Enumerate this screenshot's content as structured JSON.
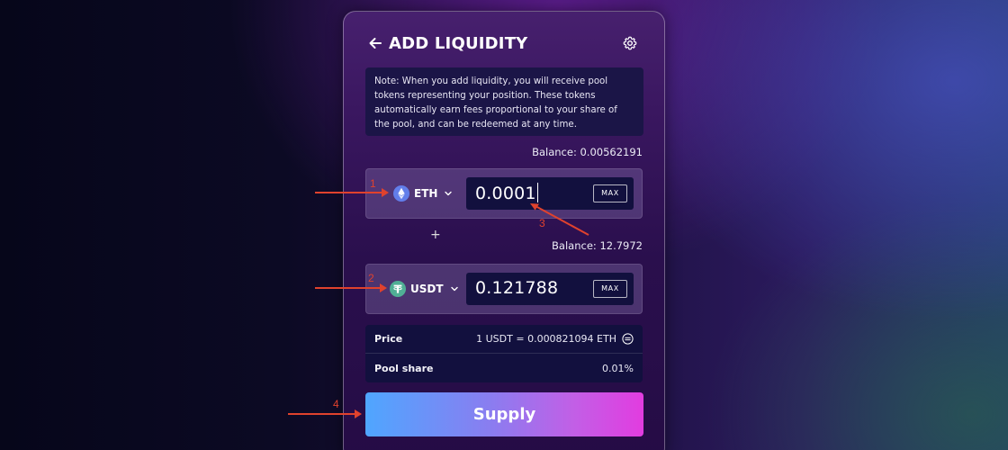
{
  "header": {
    "title": "ADD LIQUIDITY",
    "back_icon": "arrow-left-icon",
    "settings_icon": "gear-icon"
  },
  "note": {
    "text": "Note: When you add liquidity, you will receive pool tokens representing your position. These tokens automatically earn fees proportional to your share of the pool, and can be redeemed at any time."
  },
  "token_a": {
    "balance_label": "Balance: 0.00562191",
    "symbol": "ETH",
    "icon": "ethereum-icon",
    "amount": "0.0001",
    "max_label": "MAX"
  },
  "plus_sign": "+",
  "token_b": {
    "balance_label": "Balance: 12.7972",
    "symbol": "USDT",
    "icon": "tether-icon",
    "amount": "0.121788",
    "max_label": "MAX"
  },
  "info": {
    "price_label": "Price",
    "price_value": "1 USDT = 0.000821094 ETH",
    "pool_share_label": "Pool share",
    "pool_share_value": "0.01%"
  },
  "supply_button": {
    "label": "Supply"
  },
  "annotations": [
    {
      "number": "1"
    },
    {
      "number": "2"
    },
    {
      "number": "3"
    },
    {
      "number": "4"
    }
  ],
  "colors": {
    "annotation": "#e0422d",
    "eth": "#627eea",
    "usdt": "#50af95",
    "supply_gradient_start": "#4fa6ff",
    "supply_gradient_end": "#e23ce0"
  }
}
